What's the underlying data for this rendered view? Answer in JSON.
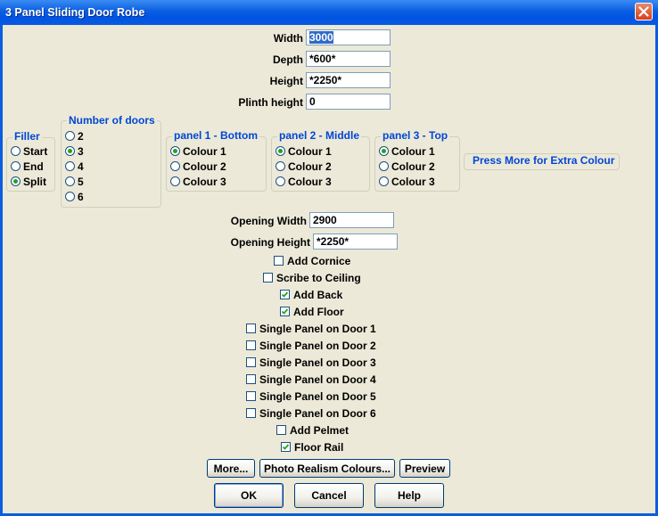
{
  "window": {
    "title": "3 Panel Sliding Door Robe"
  },
  "fields": {
    "width": {
      "label": "Width",
      "value": "3000"
    },
    "depth": {
      "label": "Depth",
      "value": "*600*"
    },
    "height": {
      "label": "Height",
      "value": "*2250*"
    },
    "plinth": {
      "label": "Plinth height",
      "value": "0"
    },
    "opening_width": {
      "label": "Opening Width",
      "value": "2900"
    },
    "opening_height": {
      "label": "Opening Height",
      "value": "*2250*"
    }
  },
  "filler": {
    "title": "Filler",
    "options": [
      "Start",
      "End",
      "Split"
    ],
    "selected": "Split"
  },
  "doors": {
    "title": "Number of doors",
    "options": [
      "2",
      "3",
      "4",
      "5",
      "6"
    ],
    "selected": "3"
  },
  "panel1": {
    "title": "panel 1 - Bottom",
    "options": [
      "Colour 1",
      "Colour 2",
      "Colour 3"
    ],
    "selected": "Colour 1"
  },
  "panel2": {
    "title": "panel 2 - Middle",
    "options": [
      "Colour 1",
      "Colour 2",
      "Colour 3"
    ],
    "selected": "Colour 1"
  },
  "panel3": {
    "title": "panel 3 - Top",
    "options": [
      "Colour 1",
      "Colour 2",
      "Colour 3"
    ],
    "selected": "Colour 1"
  },
  "extra_colour": "Press More for Extra Colour",
  "checkboxes": [
    {
      "label": "Add Cornice",
      "checked": false
    },
    {
      "label": "Scribe to Ceiling",
      "checked": false
    },
    {
      "label": "Add Back",
      "checked": true
    },
    {
      "label": "Add Floor",
      "checked": true
    },
    {
      "label": "Single Panel on Door 1",
      "checked": false
    },
    {
      "label": "Single Panel on Door 2",
      "checked": false
    },
    {
      "label": "Single Panel on Door 3",
      "checked": false
    },
    {
      "label": "Single Panel on Door 4",
      "checked": false
    },
    {
      "label": "Single Panel on Door 5",
      "checked": false
    },
    {
      "label": "Single Panel on Door 6",
      "checked": false
    },
    {
      "label": "Add Pelmet",
      "checked": false
    },
    {
      "label": "Floor Rail",
      "checked": true
    }
  ],
  "buttons": {
    "more": "More...",
    "photo": "Photo Realism Colours...",
    "preview": "Preview",
    "ok": "OK",
    "cancel": "Cancel",
    "help": "Help"
  },
  "icons": {
    "close": "close-icon",
    "check": "checkmark-icon"
  },
  "colors": {
    "accent": "#0046d5",
    "radio_dot": "#21a121",
    "titlebar": "#0054e3"
  }
}
